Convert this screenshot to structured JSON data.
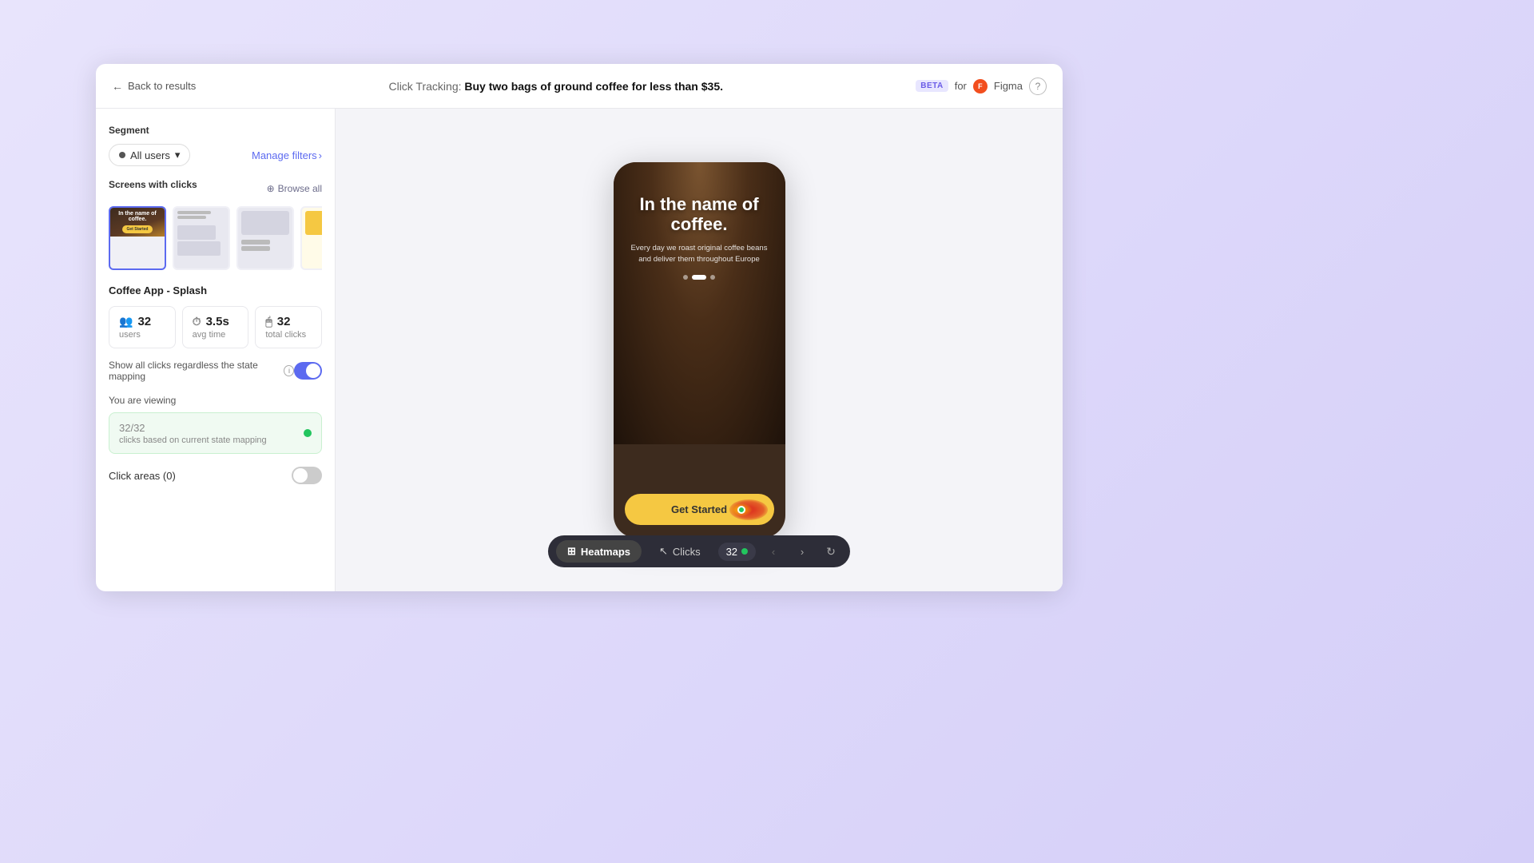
{
  "background": {
    "color": "#ddd8f8"
  },
  "header": {
    "back_label": "Back to results",
    "title_prefix": "Click Tracking:",
    "title_main": " Buy two bags of ground coffee for less than $35.",
    "beta_label": "BETA",
    "for_label": "for",
    "figma_label": "Figma",
    "help_icon": "?"
  },
  "sidebar": {
    "segment_section": "Segment",
    "segment_btn": "All users",
    "manage_filters": "Manage filters",
    "screens_section": "Screens with clicks",
    "browse_all": "Browse all",
    "screen_name": "Coffee App - Splash",
    "stats": [
      {
        "icon": "👥",
        "value": "32",
        "label": "users"
      },
      {
        "icon": "⏱",
        "value": "3.5s",
        "label": "avg time"
      },
      {
        "icon": "🖱",
        "value": "32",
        "label": "total clicks"
      }
    ],
    "toggle_label": "Show all clicks regardless the state mapping",
    "toggle_on": true,
    "viewing_label": "You are viewing",
    "viewing_count": "32",
    "viewing_total": "32",
    "viewing_desc": "clicks based on current state mapping",
    "click_areas_label": "Click areas (0)",
    "click_areas_toggle": false
  },
  "main": {
    "phone": {
      "title": "In the name of coffee.",
      "subtitle": "Every day we roast original coffee beans and deliver them throughout Europe",
      "cta_label": "Get S",
      "dots": [
        true,
        false,
        false
      ]
    }
  },
  "bottom_bar": {
    "heatmaps_label": "Heatmaps",
    "clicks_label": "Clicks",
    "count": "32",
    "prev_icon": "‹",
    "next_icon": "›",
    "refresh_icon": "↻"
  }
}
